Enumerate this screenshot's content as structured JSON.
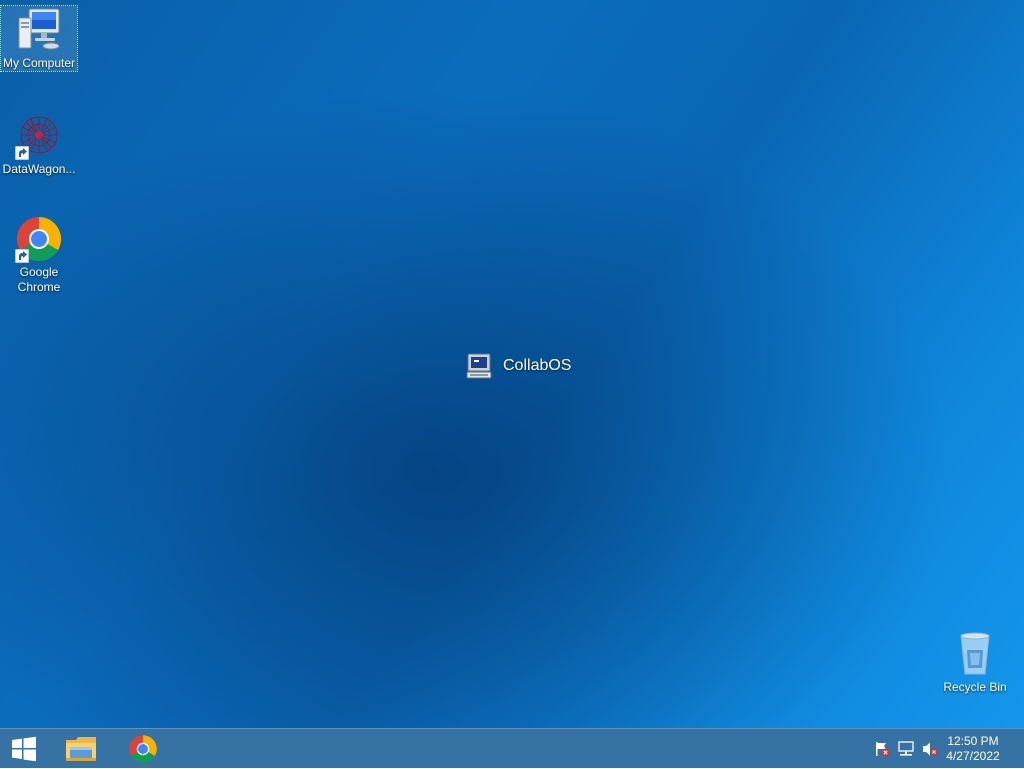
{
  "desktop": {
    "icons": [
      {
        "label": "My Computer",
        "icon": "my-computer-icon"
      },
      {
        "label": "DataWagon...",
        "icon": "datawagon-icon"
      },
      {
        "label": "Google Chrome",
        "icon": "chrome-icon"
      },
      {
        "label": "Recycle Bin",
        "icon": "recycle-bin-icon"
      }
    ],
    "center_label": "CollabOS",
    "center_icon": "collabos-computer-icon"
  },
  "taskbar": {
    "start_icon": "windows-start-icon",
    "pinned": [
      {
        "name": "File Explorer",
        "icon": "file-explorer-icon"
      },
      {
        "name": "Google Chrome",
        "icon": "chrome-icon"
      }
    ],
    "tray": [
      "action-center-flag-icon",
      "network-icon",
      "volume-muted-icon"
    ],
    "clock": {
      "time": "12:50 PM",
      "date": "4/27/2022"
    }
  },
  "colors": {
    "desktop_start": "#0a5fa8",
    "desktop_end": "#1397ec",
    "taskbar": "#2e6ca0"
  }
}
